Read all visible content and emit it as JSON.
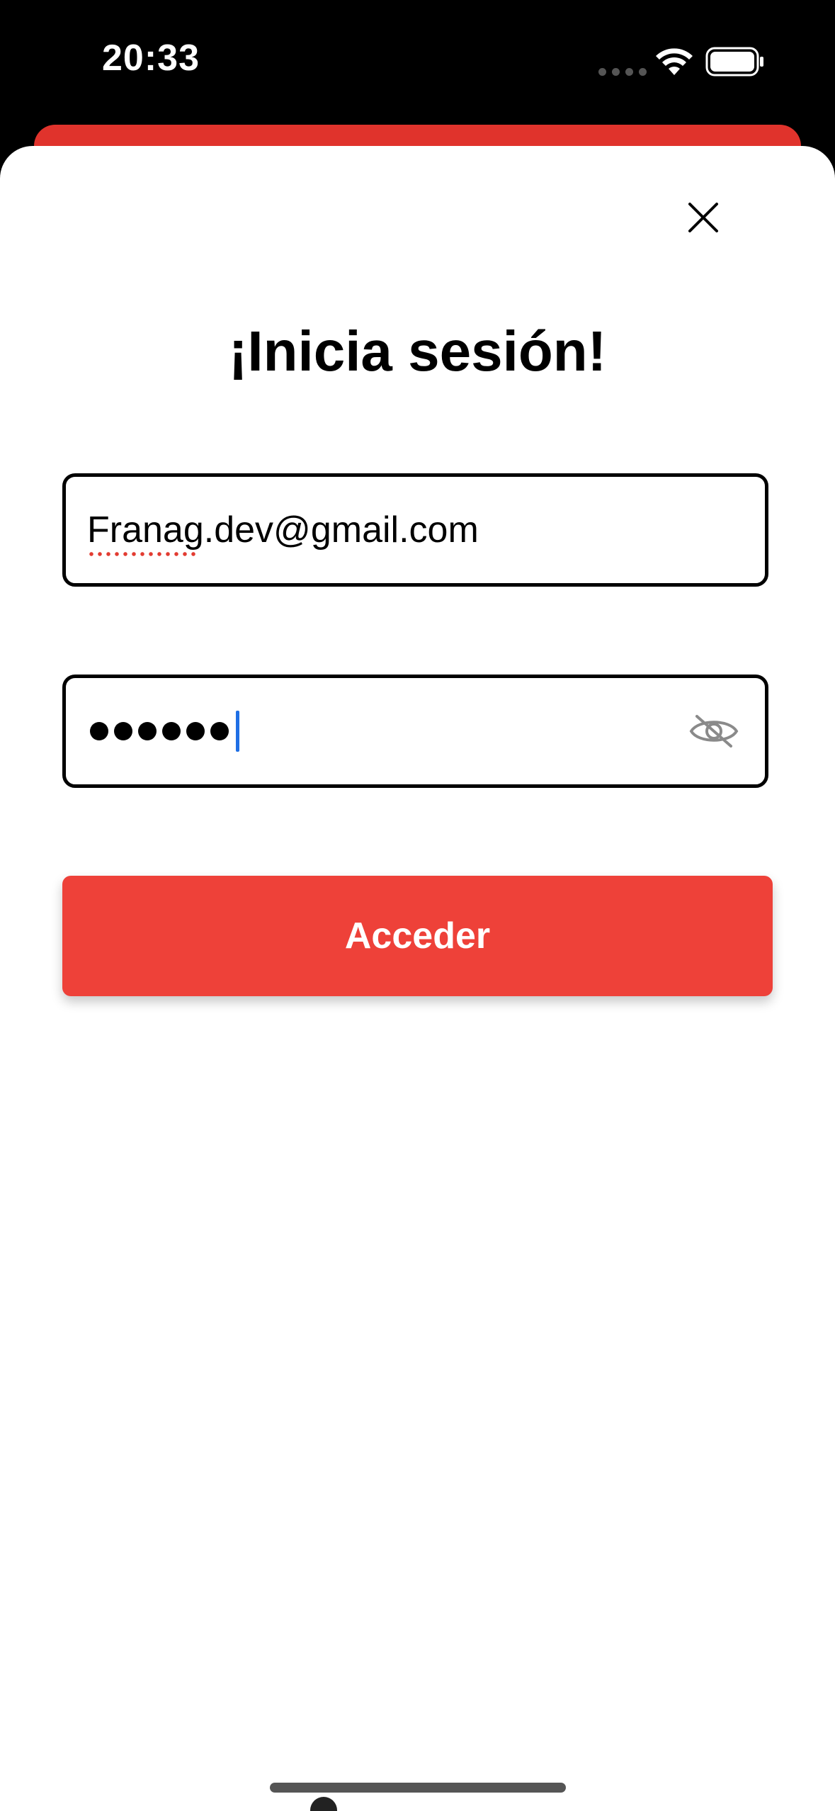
{
  "status_bar": {
    "time": "20:33",
    "wifi_icon": "wifi-icon",
    "battery_icon": "battery-icon"
  },
  "login_sheet": {
    "close_icon": "close-icon",
    "title": "¡Inicia sesión!",
    "email": {
      "value": "Franag.dev@gmail.com"
    },
    "password": {
      "masked_length": 6,
      "visibility_icon": "eye-slash-icon"
    },
    "submit_label": "Acceder"
  },
  "colors": {
    "accent": "#ee4139",
    "background_card": "#e0332c",
    "caret": "#1f6fe5"
  }
}
